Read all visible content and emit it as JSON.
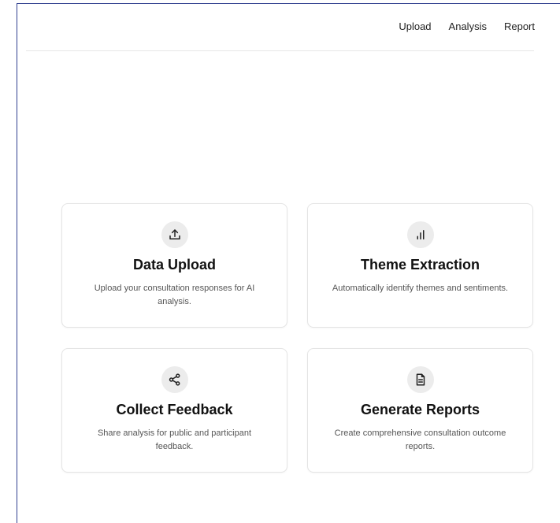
{
  "nav": {
    "items": [
      {
        "label": "Upload"
      },
      {
        "label": "Analysis"
      },
      {
        "label": "Report"
      }
    ]
  },
  "cards": [
    {
      "icon": "upload-icon",
      "title": "Data Upload",
      "description": "Upload your consultation responses for AI analysis."
    },
    {
      "icon": "bar-chart-icon",
      "title": "Theme Extraction",
      "description": "Automatically identify themes and sentiments."
    },
    {
      "icon": "share-icon",
      "title": "Collect Feedback",
      "description": "Share analysis for public and participant feedback."
    },
    {
      "icon": "document-icon",
      "title": "Generate Reports",
      "description": "Create comprehensive consultation outcome reports."
    }
  ],
  "colors": {
    "frame_border": "#2f3f8f",
    "icon_background": "#ececec",
    "card_border": "#e4e4e4"
  }
}
